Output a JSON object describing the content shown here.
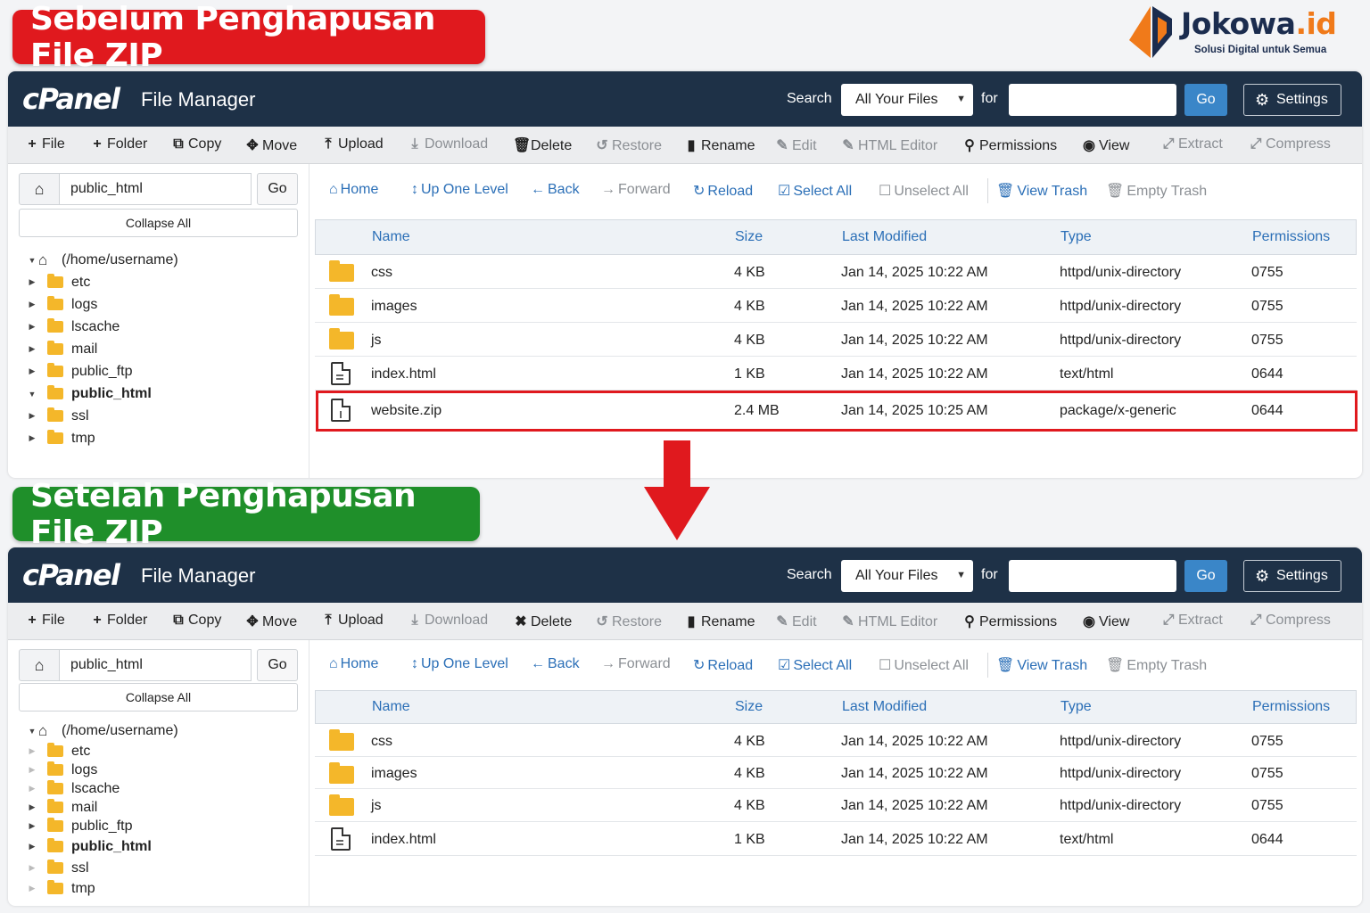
{
  "before_banner": "Sebelum Penghapusan File ZIP",
  "after_banner": "Setelah Penghapusan File ZIP",
  "brand": {
    "name": "Jokowa",
    "suffix": ".id",
    "tagline": "Solusi Digital untuk Semua",
    "color": "#1b2c4e",
    "accent": "#f07a1a"
  },
  "colors": {
    "before": "#e0191e",
    "after": "#1f8f2a",
    "topbar": "#1e3147",
    "link": "#2b6fb7",
    "folder": "#f4b72a",
    "go_button": "#3a86c8"
  },
  "header": {
    "logo": "cPanel",
    "title": "File Manager",
    "search_label": "Search",
    "search_scope": "All Your Files",
    "for_label": "for",
    "search_value": "",
    "go_label": "Go",
    "settings_label": "Settings"
  },
  "toolbar": {
    "file": "File",
    "folder": "Folder",
    "copy": "Copy",
    "move": "Move",
    "upload": "Upload",
    "download": "Download",
    "delete": "Delete",
    "restore": "Restore",
    "rename": "Rename",
    "edit": "Edit",
    "html_editor": "HTML Editor",
    "permissions": "Permissions",
    "view": "View",
    "extract": "Extract",
    "compress": "Compress"
  },
  "sidebar": {
    "path": "public_html",
    "go_label": "Go",
    "collapse_label": "Collapse All",
    "root": "(/home/username)",
    "items": [
      "etc",
      "logs",
      "lscache",
      "mail",
      "public_ftp",
      "public_html",
      "ssl",
      "tmp"
    ],
    "active_item": "public_html"
  },
  "actions": {
    "home": "Home",
    "up": "Up One Level",
    "back": "Back",
    "forward": "Forward",
    "reload": "Reload",
    "select_all": "Select All",
    "unselect_all": "Unselect All",
    "view_trash": "View Trash",
    "empty_trash": "Empty Trash"
  },
  "columns": {
    "name": "Name",
    "size": "Size",
    "modified": "Last Modified",
    "type": "Type",
    "permissions": "Permissions"
  },
  "before_files": [
    {
      "name": "css",
      "size": "4 KB",
      "modified": "Jan 14, 2025 10:22 AM",
      "type": "httpd/unix-directory",
      "perms": "0755",
      "kind": "folder"
    },
    {
      "name": "images",
      "size": "4 KB",
      "modified": "Jan 14, 2025 10:22 AM",
      "type": "httpd/unix-directory",
      "perms": "0755",
      "kind": "folder"
    },
    {
      "name": "js",
      "size": "4 KB",
      "modified": "Jan 14, 2025 10:22 AM",
      "type": "httpd/unix-directory",
      "perms": "0755",
      "kind": "folder"
    },
    {
      "name": "index.html",
      "size": "1 KB",
      "modified": "Jan 14, 2025 10:22 AM",
      "type": "text/html",
      "perms": "0644",
      "kind": "file"
    },
    {
      "name": "website.zip",
      "size": "2.4 MB",
      "modified": "Jan 14, 2025 10:25 AM",
      "type": "package/x-generic",
      "perms": "0644",
      "kind": "file",
      "highlight": true
    }
  ],
  "after_files": [
    {
      "name": "css",
      "size": "4 KB",
      "modified": "Jan 14, 2025 10:22 AM",
      "type": "httpd/unix-directory",
      "perms": "0755",
      "kind": "folder"
    },
    {
      "name": "images",
      "size": "4 KB",
      "modified": "Jan 14, 2025 10:22 AM",
      "type": "httpd/unix-directory",
      "perms": "0755",
      "kind": "folder"
    },
    {
      "name": "js",
      "size": "4 KB",
      "modified": "Jan 14, 2025 10:22 AM",
      "type": "httpd/unix-directory",
      "perms": "0755",
      "kind": "folder"
    },
    {
      "name": "index.html",
      "size": "1 KB",
      "modified": "Jan 14, 2025 10:22 AM",
      "type": "text/html",
      "perms": "0644",
      "kind": "file"
    }
  ]
}
